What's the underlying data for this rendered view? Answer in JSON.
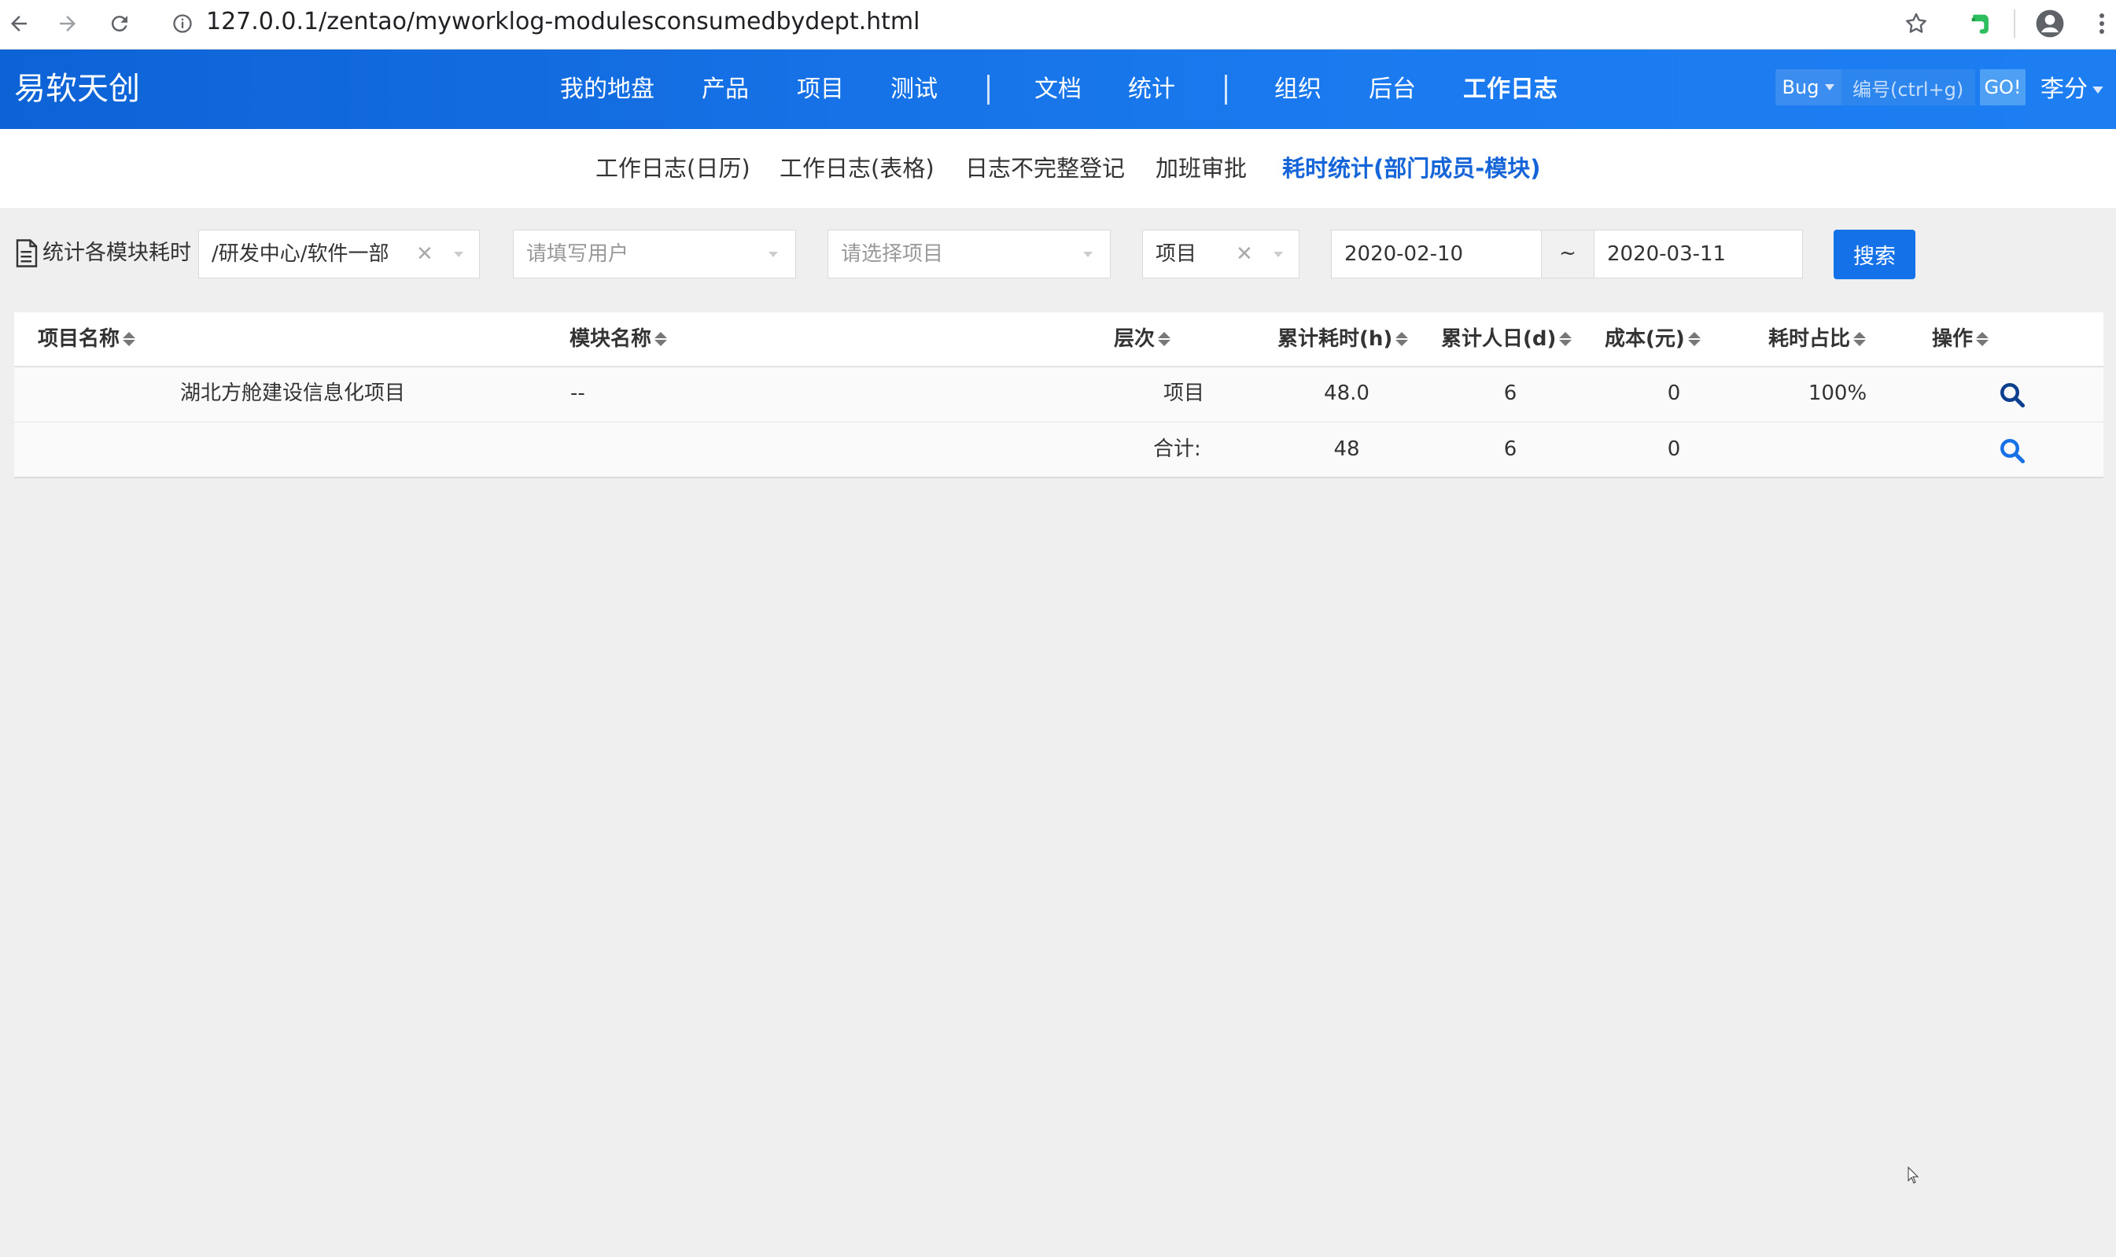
{
  "browser": {
    "url": "127.0.0.1/zentao/myworklog-modulesconsumedbydept.html"
  },
  "header": {
    "brand": "易软天创",
    "nav": [
      {
        "label": "我的地盘"
      },
      {
        "label": "产品"
      },
      {
        "label": "项目"
      },
      {
        "label": "测试"
      },
      {
        "label": "文档"
      },
      {
        "label": "统计"
      },
      {
        "label": "组织"
      },
      {
        "label": "后台"
      },
      {
        "label": "工作日志",
        "active": true
      }
    ],
    "search": {
      "type": "Bug",
      "placeholder": "编号(ctrl+g)",
      "go": "GO!"
    },
    "user": "李分"
  },
  "subnav": [
    {
      "label": "工作日志(日历)"
    },
    {
      "label": "工作日志(表格)"
    },
    {
      "label": "日志不完整登记"
    },
    {
      "label": "加班审批"
    },
    {
      "label": "耗时统计(部门成员-模块)",
      "active": true
    }
  ],
  "filter": {
    "label": "统计各模块耗时",
    "dept": "/研发中心/软件一部",
    "user_placeholder": "请填写用户",
    "project_placeholder": "请选择项目",
    "level": "项目",
    "date_from": "2020-02-10",
    "date_sep": "~",
    "date_to": "2020-03-11",
    "search_label": "搜索"
  },
  "table": {
    "columns": [
      "项目名称",
      "模块名称",
      "层次",
      "累计耗时(h)",
      "累计人日(d)",
      "成本(元)",
      "耗时占比",
      "操作"
    ],
    "rows": [
      {
        "project": "湖北方舱建设信息化项目",
        "module": "--",
        "level": "项目",
        "hours": "48.0",
        "days": "6",
        "cost": "0",
        "ratio": "100%"
      }
    ],
    "total": {
      "label": "合计:",
      "hours": "48",
      "days": "6",
      "cost": "0"
    }
  },
  "colors": {
    "header_blue": "#1a79ee",
    "active_link": "#1565d8",
    "search_button": "#1471e8"
  },
  "icons": [
    "back-arrow-icon",
    "forward-arrow-icon",
    "reload-icon",
    "info-icon",
    "star-icon",
    "evernote-icon",
    "account-icon",
    "kebab-menu-icon",
    "document-icon",
    "sort-icon",
    "magnifier-icon"
  ]
}
